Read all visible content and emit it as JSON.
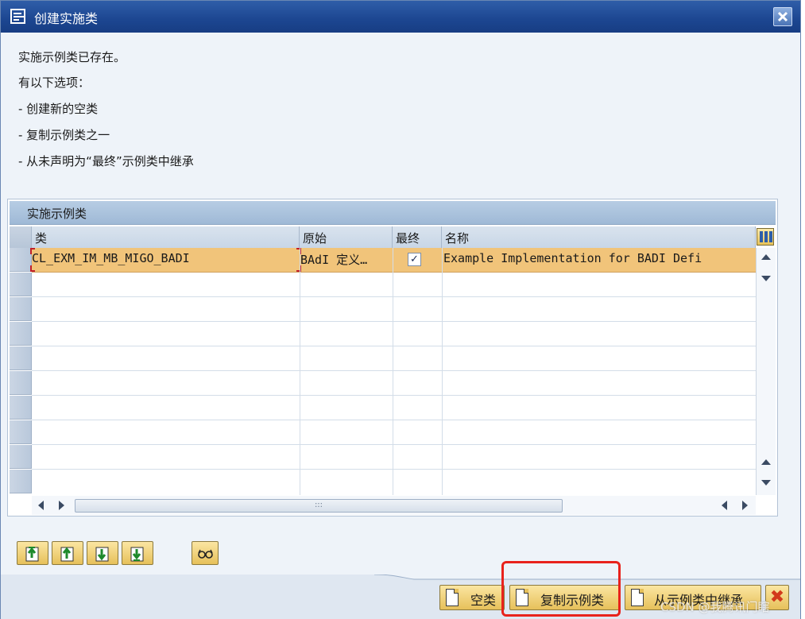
{
  "window": {
    "title": "创建实施类",
    "close_label": "✕"
  },
  "message": {
    "lines": [
      "实施示例类已存在。",
      "有以下选项：",
      "- 创建新的空类",
      "- 复制示例类之一",
      "- 从未声明为“最终”示例类中继承"
    ]
  },
  "table": {
    "title": "实施示例类",
    "columns": [
      "类",
      "原始",
      "最终",
      "名称"
    ],
    "rows": [
      {
        "class": "CL_EXM_IM_MB_MIGO_BADI",
        "origin": "BAdI 定义…",
        "final": true,
        "name": "Example Implementation for BADI Defi"
      }
    ],
    "empty_row_count": 9
  },
  "footer": {
    "buttons": [
      {
        "label": "空类"
      },
      {
        "label": "复制示例类"
      },
      {
        "label": "从示例类中继承"
      }
    ],
    "cancel_label": "✖"
  },
  "watermark": "CSDN @我腾讯门瞎",
  "colors": {
    "title_bar": "#1c4691",
    "selected_row": "#f1c47a",
    "highlight": "#e8221c",
    "button": "#e6c05a"
  }
}
